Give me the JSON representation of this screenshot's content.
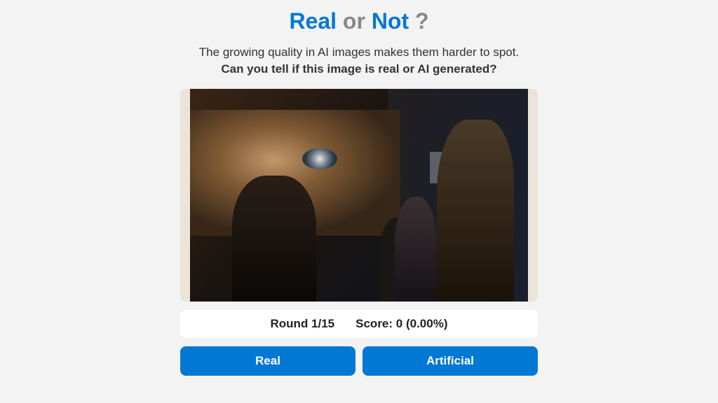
{
  "title": {
    "real": "Real",
    "or": "or",
    "not": "Not",
    "q": "?"
  },
  "subtitle": {
    "line1": "The growing quality in AI images makes them harder to spot.",
    "line2": "Can you tell if this image is real or AI generated?"
  },
  "status": {
    "round_label": "Round 1/15",
    "score_label": "Score: 0 (0.00%)"
  },
  "buttons": {
    "real": "Real",
    "artificial": "Artificial"
  }
}
